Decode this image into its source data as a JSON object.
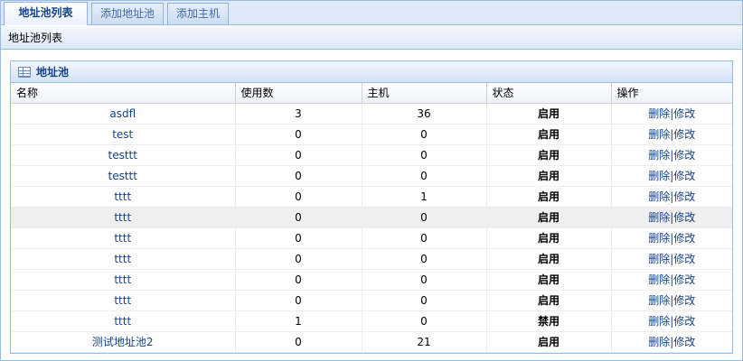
{
  "tabs": [
    {
      "label": "地址池列表",
      "active": true
    },
    {
      "label": "添加地址池",
      "active": false
    },
    {
      "label": "添加主机",
      "active": false
    }
  ],
  "subheader": "地址池列表",
  "panel": {
    "title": "地址池",
    "columns": [
      "名称",
      "使用数",
      "主机",
      "状态",
      "操作"
    ],
    "delete_label": "删除",
    "separator": "|",
    "edit_label": "修改",
    "rows": [
      {
        "name": "asdfl",
        "used": "3",
        "hosts": "36",
        "status": "启用"
      },
      {
        "name": "test",
        "used": "0",
        "hosts": "0",
        "status": "启用"
      },
      {
        "name": "testtt",
        "used": "0",
        "hosts": "0",
        "status": "启用"
      },
      {
        "name": "testtt",
        "used": "0",
        "hosts": "0",
        "status": "启用"
      },
      {
        "name": "tttt",
        "used": "0",
        "hosts": "1",
        "status": "启用"
      },
      {
        "name": "tttt",
        "used": "0",
        "hosts": "0",
        "status": "启用"
      },
      {
        "name": "tttt",
        "used": "0",
        "hosts": "0",
        "status": "启用"
      },
      {
        "name": "tttt",
        "used": "0",
        "hosts": "0",
        "status": "启用"
      },
      {
        "name": "tttt",
        "used": "0",
        "hosts": "0",
        "status": "启用"
      },
      {
        "name": "tttt",
        "used": "0",
        "hosts": "0",
        "status": "启用"
      },
      {
        "name": "tttt",
        "used": "1",
        "hosts": "0",
        "status": "禁用"
      },
      {
        "name": "测试地址池2",
        "used": "0",
        "hosts": "21",
        "status": "启用"
      }
    ]
  },
  "colors": {
    "accent": "#15428b",
    "border": "#99bbe8",
    "header_bg": "#dfe8f6"
  },
  "icons": {
    "panel_icon": "grid-icon"
  }
}
